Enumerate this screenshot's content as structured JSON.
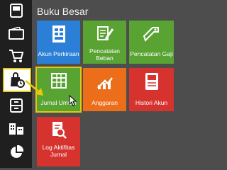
{
  "section_title": "Buku Besar",
  "colors": {
    "sidebar": "#1f1f1f",
    "panel": "#4d4d4d",
    "highlight": "#e8c80c",
    "blue": "#2b7fd6",
    "green": "#58a332",
    "orange": "#ec6d1a",
    "red": "#d6332f"
  },
  "sidebar_icons": [
    "dashboard-icon",
    "wallet-icon",
    "cart-icon",
    "ledger-bag-icon",
    "archive-icon",
    "building-icon",
    "pie-chart-icon"
  ],
  "tiles": [
    {
      "label": "Akun Perkiraan",
      "icon": "account-book-icon",
      "color": "blue"
    },
    {
      "label": "Pencatatan Beban",
      "icon": "expense-note-icon",
      "color": "green"
    },
    {
      "label": "Pencatatan Gaji",
      "icon": "salary-tag-icon",
      "color": "green"
    },
    {
      "label": "Jurnal Umum",
      "icon": "journal-grid-icon",
      "color": "green"
    },
    {
      "label": "Anggaran",
      "icon": "budget-icon",
      "color": "orange"
    },
    {
      "label": "Histori Akun",
      "icon": "history-book-icon",
      "color": "red"
    },
    {
      "label": "Log Aktifitas Jurnal",
      "icon": "log-search-icon",
      "color": "red"
    }
  ],
  "selected_tile": "Jurnal Umum"
}
